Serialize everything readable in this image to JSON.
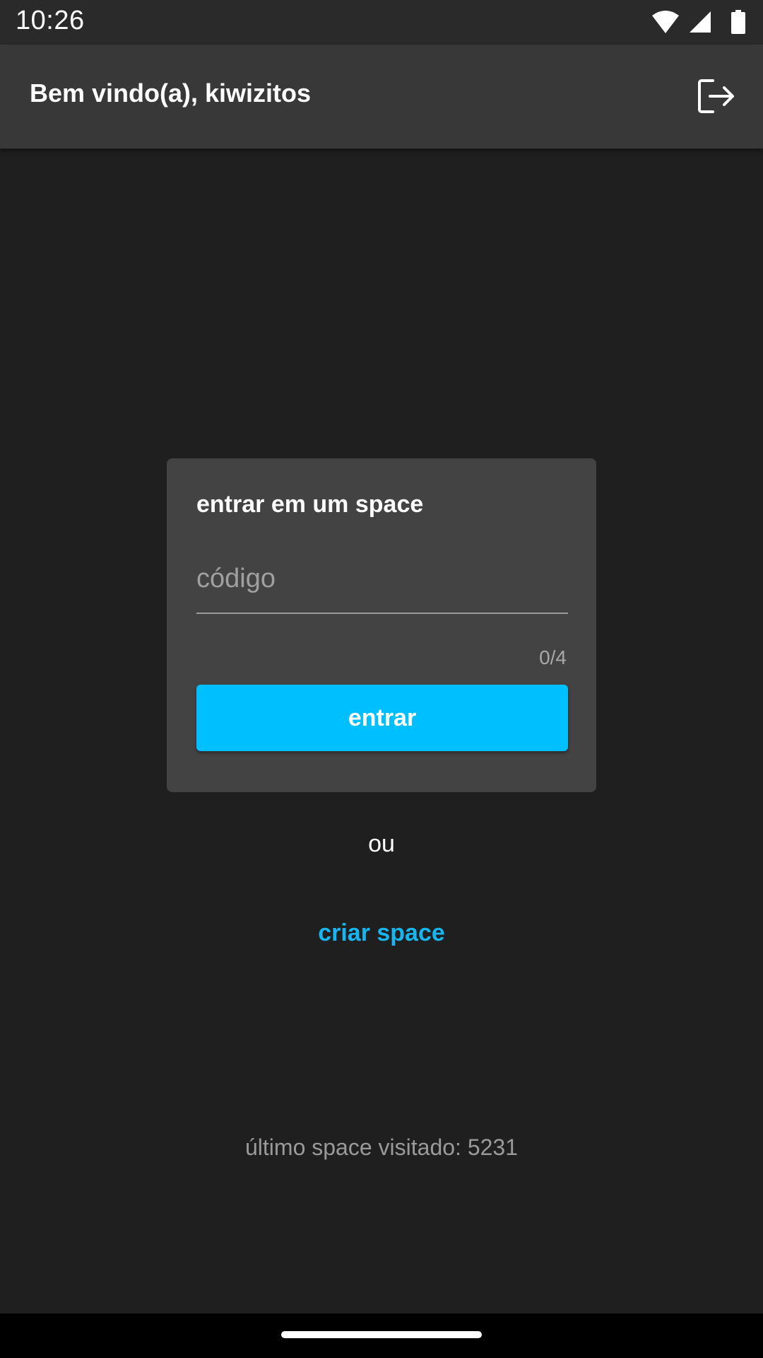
{
  "status_bar": {
    "time": "10:26",
    "icons": [
      "wifi-icon",
      "cellular-signal-icon",
      "battery-icon"
    ]
  },
  "app_bar": {
    "title": "Bem vindo(a), kiwizitos",
    "logout_icon": "logout-icon"
  },
  "join_card": {
    "title": "entrar em um space",
    "code_input": {
      "value": "",
      "placeholder": "código"
    },
    "counter": "0/4",
    "submit_label": "entrar"
  },
  "separator": "ou",
  "create_label": "criar space",
  "last_visited": "último space visitado: 5231",
  "colors": {
    "background": "#1f1f1f",
    "app_bar": "#383838",
    "card": "#434343",
    "accent": "#00bfff",
    "link": "#17b6f0"
  }
}
